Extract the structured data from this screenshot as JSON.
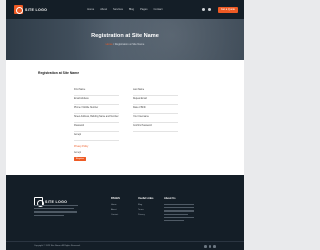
{
  "header": {
    "logo_text": "SITE LOGO",
    "nav": [
      "Home",
      "About",
      "Services",
      "Blog",
      "Pages",
      "Contact"
    ],
    "cta_label": "Get a Quote"
  },
  "hero": {
    "title": "Registration at Site Name",
    "breadcrumb_home": "Home",
    "breadcrumb_current": "Registration at Site Name"
  },
  "registration": {
    "title": "Registration at Site Name",
    "fields_left": [
      "First Name",
      "Email Address",
      "Phone / Mobile Number",
      "Your Username",
      "Confirm Password"
    ],
    "fields_right": [
      "Last Name",
      "Repeat Email",
      "Date of Birth",
      "Password"
    ],
    "field_full": "Street Address, Building Name and Number",
    "privacy_link": "Privacy Policy",
    "terms_text": "Accept",
    "register_label": "Register"
  },
  "footer": {
    "logo_text": "SITE LOGO",
    "col1_heading": "PAGES",
    "col1_links": [
      "Home",
      "About",
      "Contact"
    ],
    "col2_heading": "Useful Links",
    "col2_links": [
      "Blog",
      "Terms",
      "Privacy"
    ],
    "col3_heading": "About Us",
    "copyright": "Copyright © 2023 Site Name. All Rights Reserved."
  },
  "colors": {
    "accent": "#ee5a24",
    "dark": "#141e27"
  }
}
